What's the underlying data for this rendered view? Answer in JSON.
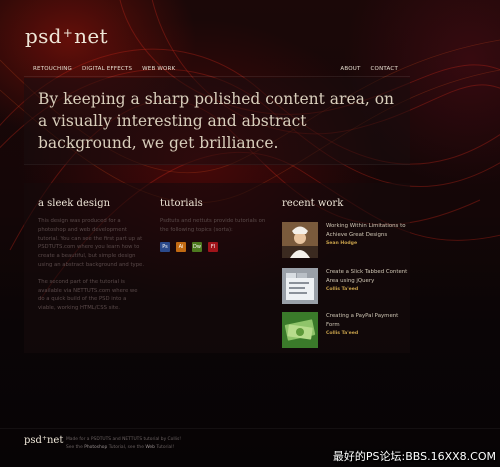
{
  "brand": {
    "logo_left": "psd",
    "logo_plus": "+",
    "logo_right": "net"
  },
  "nav": {
    "left": [
      "RETOUCHING",
      "DIGITAL EFFECTS",
      "WEB WORK"
    ],
    "right": [
      "ABOUT",
      "CONTACT"
    ]
  },
  "hero": {
    "text": "By keeping a sharp polished content area, on a visually interesting and abstract background, we get brilliance."
  },
  "sections": {
    "sleek": {
      "title": "a sleek design",
      "paragraph1": "This design was produced for a photoshop and web development tutorial. You can see the first part up at PSDTUTS.com where you learn how to create a beautiful, but simple design using an abstract background and type.",
      "paragraph2": "The second part of the tutorial is available via NETTUTS.com where we do a quick build of the PSD into a viable, working HTML/CSS site."
    },
    "tutorials": {
      "title": "tutorials",
      "text": "Psdtuts and nettuts provide tutorials on the following topics (sorta):",
      "icons": [
        {
          "label": "Ps",
          "icon": "photoshop-icon",
          "color": "#2b4a8c"
        },
        {
          "label": "Ai",
          "icon": "illustrator-icon",
          "color": "#c26a12"
        },
        {
          "label": "Dw",
          "icon": "dreamweaver-icon",
          "color": "#4d7a1f"
        },
        {
          "label": "Fl",
          "icon": "flash-icon",
          "color": "#a0141a"
        }
      ]
    },
    "recent": {
      "title": "recent work",
      "items": [
        {
          "title": "Working Within Limitations to Achieve Great Designs",
          "author": "Sean Hodge"
        },
        {
          "title": "Create a Slick Tabbed Content Area using jQuery",
          "author": "Collis Ta'eed"
        },
        {
          "title": "Creating a PayPal Payment Form",
          "author": "Collis Ta'eed"
        }
      ]
    }
  },
  "footer": {
    "logo_left": "psd",
    "logo_plus": "+",
    "logo_right": "net",
    "line1": "Made for a PSDTUTS and NETTUTS tutorial by Collis!",
    "line2_prefix": "See the",
    "line2_link1": "Photoshop",
    "line2_middle": "Tutorial, see the",
    "line2_link2": "Web",
    "line2_suffix": "Tutorial!"
  },
  "watermark": "最好的PS论坛:BBS.16XX8.COM"
}
